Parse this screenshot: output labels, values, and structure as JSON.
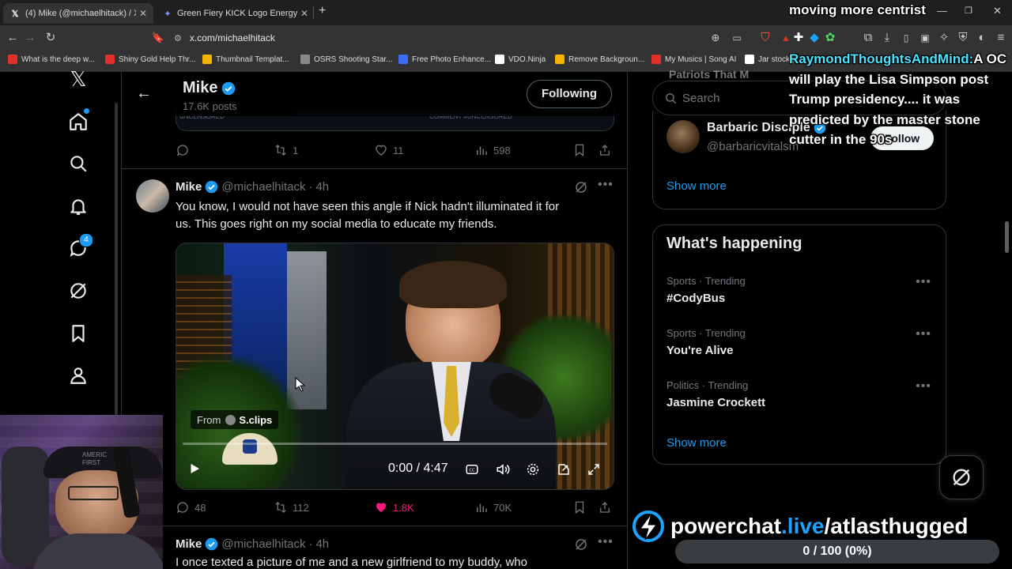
{
  "browser": {
    "tabs": [
      {
        "title": "(4) Mike (@michaelhitack) / X",
        "icon": "x-logo-icon"
      },
      {
        "title": "Green Fiery KICK Logo Energy - Goo",
        "icon": "gemini-icon"
      }
    ],
    "new_tab": "+",
    "url": "x.com/michaelhitack",
    "bookmarks": [
      {
        "label": "What is the deep w...",
        "color": "#e0302a"
      },
      {
        "label": "Shiny Gold Help Thr...",
        "color": "#e0302a"
      },
      {
        "label": "Thumbnail Templat...",
        "color": "#f4b400"
      },
      {
        "label": "OSRS Shooting Star...",
        "color": "#888888"
      },
      {
        "label": "Free Photo Enhance...",
        "color": "#3b6ef5"
      },
      {
        "label": "VDO.Ninja",
        "color": "#ffffff"
      },
      {
        "label": "Remove Backgroun...",
        "color": "#f4b400"
      },
      {
        "label": "My Musics | Song AI",
        "color": "#e0302a"
      },
      {
        "label": "Jar stock p",
        "color": "#ffffff"
      }
    ]
  },
  "profile": {
    "name": "Mike",
    "posts_count": "17.6K posts",
    "following_button": "Following",
    "uncensored_banner": "UNCENSORED",
    "comment_banner": "COMMENT #UNCENSORED"
  },
  "prev_post_actions": {
    "replies": "",
    "reposts": "1",
    "likes": "11",
    "views": "598"
  },
  "post": {
    "display_name": "Mike",
    "handle": "@michaelhitack",
    "separator": "·",
    "time": "4h",
    "text_line1": "You know, I would not have seen this angle if Nick hadn't illuminated it for",
    "text_line2": "us. This goes right on my social media to educate my friends.",
    "video": {
      "from_label": "From",
      "source": "S.clips",
      "time": "0:00 / 4:47"
    },
    "actions": {
      "replies": "48",
      "reposts": "112",
      "likes": "1.8K",
      "views": "70K"
    }
  },
  "next_post": {
    "display_name": "Mike",
    "handle": "@michaelhitack",
    "separator": "·",
    "time": "4h",
    "text": "I once texted a picture of me and a new girlfriend to my buddy, who"
  },
  "sidebar": {
    "search_placeholder": "Search",
    "top_cut_text": "Patriots That M",
    "who_to_follow": {
      "name": "Barbaric Disciple",
      "handle": "@barbaricvitalsm",
      "button": "Follow",
      "show_more": "Show more"
    },
    "whats_happening": {
      "title": "What's happening",
      "trends": [
        {
          "meta": "Sports · Trending",
          "name": "#CodyBus"
        },
        {
          "meta": "Sports · Trending",
          "name": "You're Alive"
        },
        {
          "meta": "Politics · Trending",
          "name": "Jasmine Crockett"
        }
      ],
      "show_more": "Show more"
    }
  },
  "nav": {
    "messages_badge": "4"
  },
  "stream_overlay": {
    "top_text": "moving more centrist",
    "chat_user": "RaymondThoughtsAndMind:",
    "chat_message": "A OC will play the Lisa Simpson post Trump presidency.... it was predicted by the master stone cutter in the 90s",
    "powerchat_prefix": "powerchat",
    "powerchat_domain": ".live",
    "powerchat_path": "/atlasthugged",
    "goal": "0 / 100 (0%)",
    "goal_fraction": 0,
    "webcam_shirt_text": "AMERIC FIRST"
  },
  "colors": {
    "accent": "#1d9bf0",
    "like": "#f91880",
    "powerchat_blue": "#1aa3ff"
  }
}
